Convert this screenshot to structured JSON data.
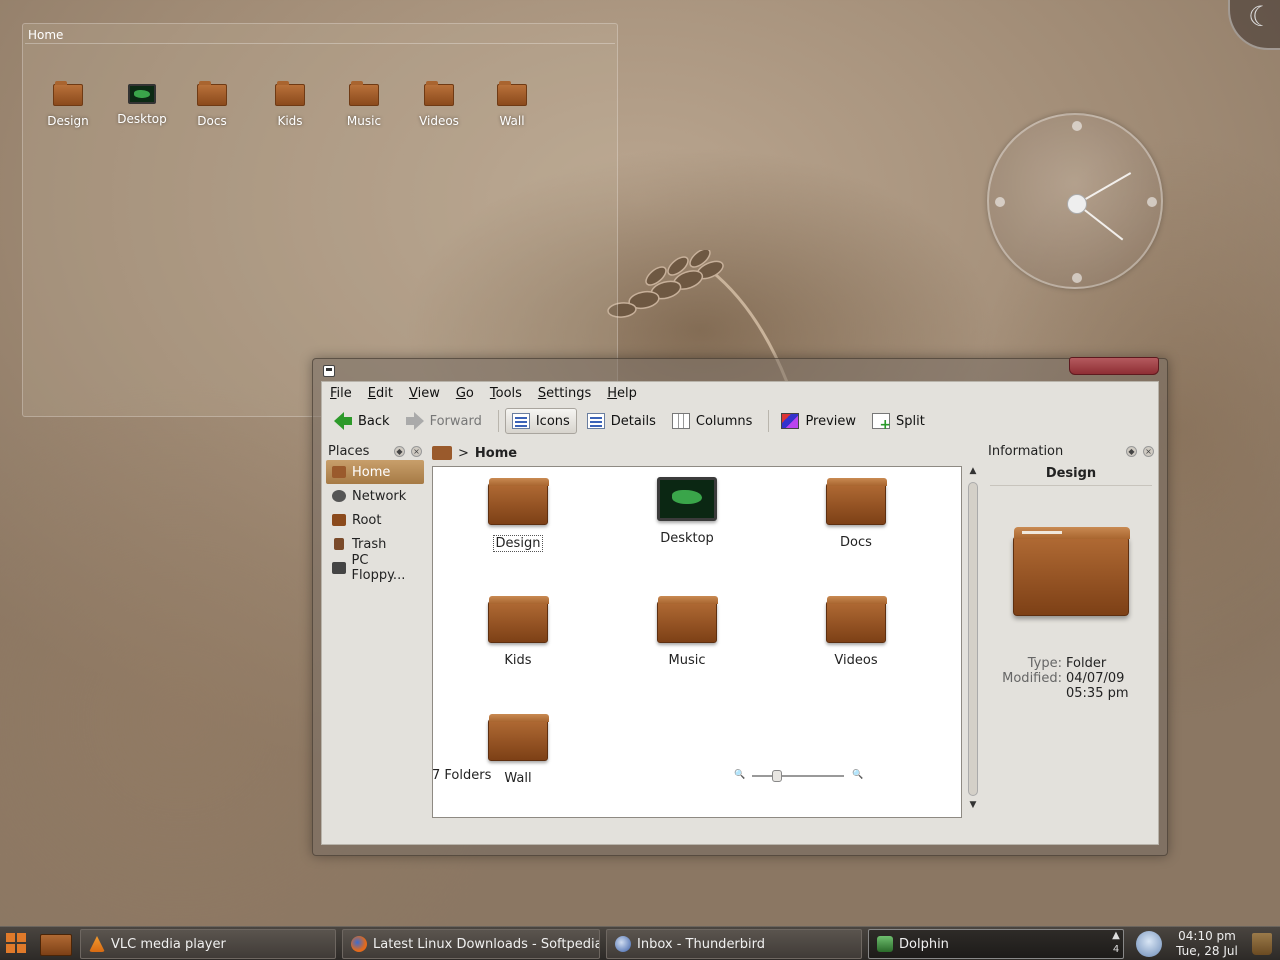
{
  "folderview": {
    "title": "Home",
    "items": [
      {
        "label": "Design",
        "icon": "folder-icon"
      },
      {
        "label": "Desktop",
        "icon": "monitor-icon"
      },
      {
        "label": "Docs",
        "icon": "folder-icon"
      },
      {
        "label": "Kids",
        "icon": "folder-icon"
      },
      {
        "label": "Music",
        "icon": "folder-icon"
      },
      {
        "label": "Videos",
        "icon": "folder-icon"
      },
      {
        "label": "Wall",
        "icon": "folder-icon"
      }
    ]
  },
  "clock": {
    "hour_hand_deg": -30,
    "minute_hand_deg": 38
  },
  "menu": [
    "File",
    "Edit",
    "View",
    "Go",
    "Tools",
    "Settings",
    "Help"
  ],
  "toolbar": {
    "back": "Back",
    "forward": "Forward",
    "icons": "Icons",
    "details": "Details",
    "columns": "Columns",
    "preview": "Preview",
    "split": "Split"
  },
  "places": {
    "title": "Places",
    "items": [
      "Home",
      "Network",
      "Root",
      "Trash",
      "PC Floppy..."
    ],
    "selected": "Home"
  },
  "breadcrumb": {
    "current": "Home"
  },
  "files": [
    "Design",
    "Desktop",
    "Docs",
    "Kids",
    "Music",
    "Videos",
    "Wall"
  ],
  "status": {
    "text": "7 Folders"
  },
  "info": {
    "title": "Information",
    "name": "Design",
    "type_label": "Type:",
    "type_value": "Folder",
    "modified_label": "Modified:",
    "modified_value": "04/07/09 05:35 pm"
  },
  "taskbar": {
    "tasks": [
      {
        "label": "VLC media player",
        "icon": "vlc-icon"
      },
      {
        "label": "Latest Linux Downloads - Softpedia",
        "icon": "firefox-icon"
      },
      {
        "label": "Inbox - Thunderbird",
        "icon": "thunderbird-icon"
      },
      {
        "label": "Dolphin",
        "icon": "dolphin-icon"
      }
    ],
    "desktop_count": "4",
    "time": "04:10 pm",
    "date": "Tue, 28 Jul"
  },
  "colors": {
    "selection": "#b88a55",
    "folder": "#9a5a2c",
    "accent_close": "#8e2e34"
  }
}
